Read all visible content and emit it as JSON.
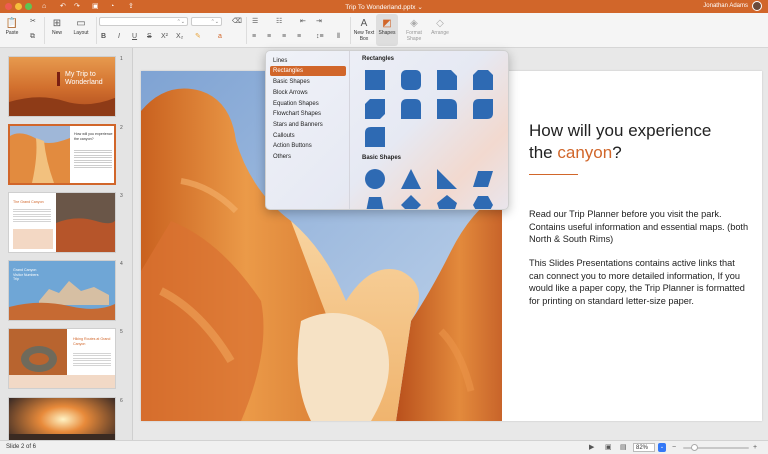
{
  "window": {
    "title": "Trip To Wonderland.pptx",
    "user": "Jonathan Adams",
    "accent": "#d1662a"
  },
  "ribbon": {
    "paste": "Paste",
    "new": "New",
    "layout": "Layout",
    "new_text_box": "New Text\nBox",
    "shapes": "Shapes",
    "format_shape": "Format\nShape",
    "arrange": "Arrange",
    "bold": "B",
    "italic": "I",
    "underline": "U",
    "strike": "S"
  },
  "slides": [
    {
      "number": "1",
      "title": "My Trip to\nWonderland"
    },
    {
      "number": "2",
      "title": "How will you experience the canyon?"
    },
    {
      "number": "3",
      "title": "The Grand Canyon"
    },
    {
      "number": "4",
      "title": "Grand Canyon Visitor Numbers Trip"
    },
    {
      "number": "5",
      "title": "Hiking Routes at Grand Canyon"
    },
    {
      "number": "6",
      "title": ""
    }
  ],
  "slide": {
    "heading_1": "How will you experience",
    "heading_2_pre": "the ",
    "heading_2_accent": "canyon",
    "heading_2_post": "?",
    "para1": "Read our Trip Planner before you visit the park. Contains useful information and essential maps. (both North & South Rims)",
    "para2": "This Slides Presentations contains active links that can connect you to more detailed information, If you would like a paper copy, the Trip Planner is formatted for printing on standard letter-size paper."
  },
  "shapes_menu": {
    "categories": [
      "Lines",
      "Rectangles",
      "Basic Shapes",
      "Block Arrows",
      "Equation Shapes",
      "Flowchart Shapes",
      "Stars and Banners",
      "Callouts",
      "Action Buttons",
      "Others"
    ],
    "active_category": "Rectangles",
    "section_rectangles": "Rectangles",
    "section_basic": "Basic Shapes",
    "shape_color": "#2e6ab3"
  },
  "status": {
    "slide_info": "Slide 2 of 6",
    "zoom": "82%"
  }
}
